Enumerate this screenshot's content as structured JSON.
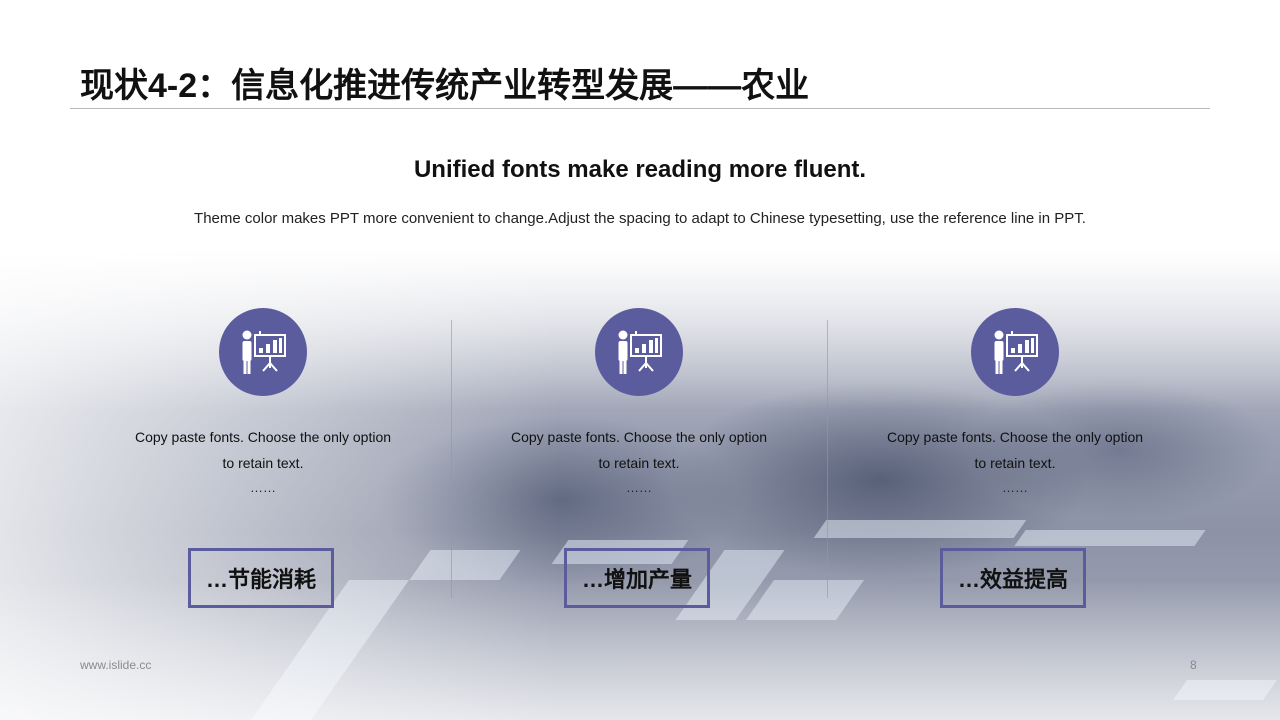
{
  "slide": {
    "title": "现状4-2：信息化推进传统产业转型发展——农业",
    "headline": "Unified fonts make reading more fluent.",
    "subline": "Theme color makes PPT more convenient to change.Adjust the spacing to adapt to Chinese typesetting, use the reference line in PPT.",
    "accent_color": "#5b5c9d"
  },
  "columns": [
    {
      "icon": "presenter-chart-icon",
      "desc_line1": "Copy paste fonts. Choose the only option",
      "desc_line2": "to retain text.",
      "ellipsis": "……",
      "tag": "…节能消耗"
    },
    {
      "icon": "presenter-chart-icon",
      "desc_line1": "Copy paste fonts. Choose the only option",
      "desc_line2": "to retain text.",
      "ellipsis": "……",
      "tag": "…增加产量"
    },
    {
      "icon": "presenter-chart-icon",
      "desc_line1": "Copy paste fonts. Choose the only option",
      "desc_line2": "to retain text.",
      "ellipsis": "……",
      "tag": "…效益提高"
    }
  ],
  "footer": {
    "website": "www.islide.cc",
    "page_number": "8"
  }
}
